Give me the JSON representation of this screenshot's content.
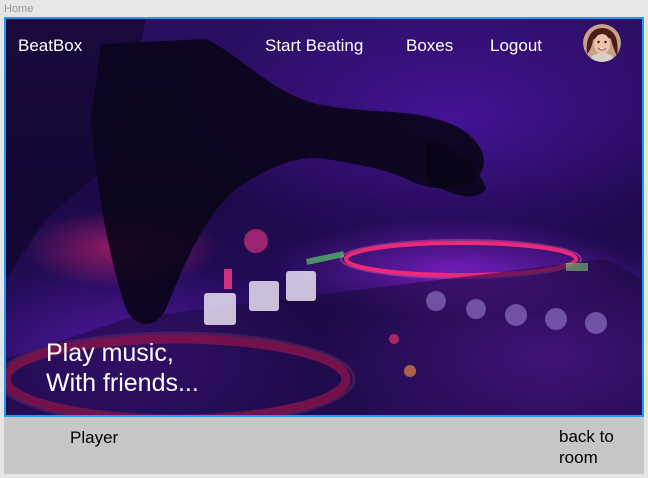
{
  "frame": {
    "label": "Home"
  },
  "navbar": {
    "brand": "BeatBox",
    "links": [
      {
        "label": "Start Beating"
      },
      {
        "label": "Boxes"
      },
      {
        "label": "Logout"
      }
    ],
    "avatar_icon": "user-avatar"
  },
  "hero": {
    "headline_lines": [
      "Play music,",
      "With friends..."
    ],
    "accent_color": "#1d9bf0"
  },
  "footer": {
    "player_label": "Player",
    "back_label": "back to room"
  }
}
